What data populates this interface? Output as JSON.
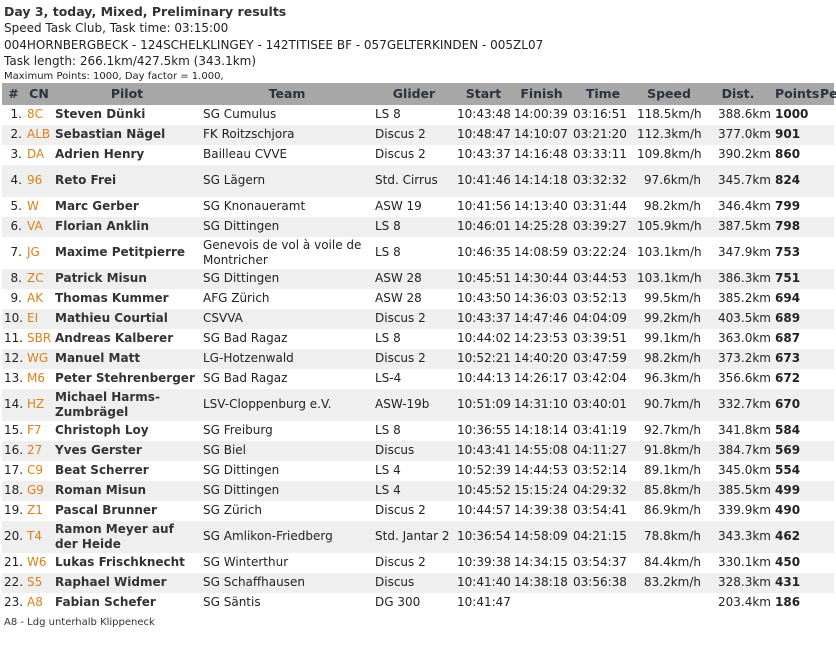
{
  "header": {
    "title": "Day 3, today, Mixed, Preliminary results",
    "competition": "Speed Task Club, Task time: 03:15:00",
    "route": "004HORNBERGBECK - 124SCHELKLINGEY - 142TITISEE BF - 057GELTERKINDEN - 005ZL07",
    "task_length": "Task length: 266.1km/427.5km (343.1km)",
    "max_points": "Maximum Points: 1000, Day factor = 1.000,"
  },
  "columns": [
    "#",
    "CN",
    "Pilot",
    "Team",
    "Glider",
    "Start",
    "Finish",
    "Time",
    "Speed",
    "Dist.",
    "Points",
    "Pen."
  ],
  "rows": [
    {
      "rank": "1.",
      "cn": "8C",
      "pilot": "Steven Dünki",
      "team": "SG Cumulus",
      "glider": "LS 8",
      "start": "10:43:48",
      "finish": "14:00:39",
      "time": "03:16:51",
      "speed": "118.5km/h",
      "dist": "388.6km",
      "points": "1000",
      "pen": ""
    },
    {
      "rank": "2.",
      "cn": "ALB",
      "pilot": "Sebastian Nägel",
      "team": "FK Roitzschjora",
      "glider": "Discus 2",
      "start": "10:48:47",
      "finish": "14:10:07",
      "time": "03:21:20",
      "speed": "112.3km/h",
      "dist": "377.0km",
      "points": "901",
      "pen": ""
    },
    {
      "rank": "3.",
      "cn": "DA",
      "pilot": "Adrien Henry",
      "team": "Bailleau CVVE",
      "glider": "Discus 2",
      "start": "10:43:37",
      "finish": "14:16:48",
      "time": "03:33:11",
      "speed": "109.8km/h",
      "dist": "390.2km",
      "points": "860",
      "pen": ""
    },
    {
      "rank": "4.",
      "cn": "96",
      "pilot": "Reto Frei",
      "team": "SG Lägern",
      "glider": "Std. Cirrus",
      "start": "10:41:46",
      "finish": "14:14:18",
      "time": "03:32:32",
      "speed": "97.6km/h",
      "dist": "345.7km",
      "points": "824",
      "pen": "",
      "tall": true
    },
    {
      "rank": "5.",
      "cn": "W",
      "pilot": "Marc Gerber",
      "team": "SG Knonaueramt",
      "glider": "ASW 19",
      "start": "10:41:56",
      "finish": "14:13:40",
      "time": "03:31:44",
      "speed": "98.2km/h",
      "dist": "346.4km",
      "points": "799",
      "pen": ""
    },
    {
      "rank": "6.",
      "cn": "VA",
      "pilot": "Florian Anklin",
      "team": "SG Dittingen",
      "glider": "LS 8",
      "start": "10:46:01",
      "finish": "14:25:28",
      "time": "03:39:27",
      "speed": "105.9km/h",
      "dist": "387.5km",
      "points": "798",
      "pen": ""
    },
    {
      "rank": "7.",
      "cn": "JG",
      "pilot": "Maxime Petitpierre",
      "team": "Genevois de vol à voile de Montricher",
      "glider": "LS 8",
      "start": "10:46:35",
      "finish": "14:08:59",
      "time": "03:22:24",
      "speed": "103.1km/h",
      "dist": "347.9km",
      "points": "753",
      "pen": "",
      "tall": true
    },
    {
      "rank": "8.",
      "cn": "ZC",
      "pilot": "Patrick Misun",
      "team": "SG Dittingen",
      "glider": "ASW 28",
      "start": "10:45:51",
      "finish": "14:30:44",
      "time": "03:44:53",
      "speed": "103.1km/h",
      "dist": "386.3km",
      "points": "751",
      "pen": ""
    },
    {
      "rank": "9.",
      "cn": "AK",
      "pilot": "Thomas Kummer",
      "team": "AFG Zürich",
      "glider": "ASW 28",
      "start": "10:43:50",
      "finish": "14:36:03",
      "time": "03:52:13",
      "speed": "99.5km/h",
      "dist": "385.2km",
      "points": "694",
      "pen": ""
    },
    {
      "rank": "10.",
      "cn": "EI",
      "pilot": "Mathieu Courtial",
      "team": "CSVVA",
      "glider": "Discus 2",
      "start": "10:43:37",
      "finish": "14:47:46",
      "time": "04:04:09",
      "speed": "99.2km/h",
      "dist": "403.5km",
      "points": "689",
      "pen": ""
    },
    {
      "rank": "11.",
      "cn": "SBR",
      "pilot": "Andreas Kalberer",
      "team": "SG Bad Ragaz",
      "glider": "LS 8",
      "start": "10:44:02",
      "finish": "14:23:53",
      "time": "03:39:51",
      "speed": "99.1km/h",
      "dist": "363.0km",
      "points": "687",
      "pen": ""
    },
    {
      "rank": "12.",
      "cn": "WG",
      "pilot": "Manuel Matt",
      "team": "LG-Hotzenwald",
      "glider": "Discus 2",
      "start": "10:52:21",
      "finish": "14:40:20",
      "time": "03:47:59",
      "speed": "98.2km/h",
      "dist": "373.2km",
      "points": "673",
      "pen": ""
    },
    {
      "rank": "13.",
      "cn": "M6",
      "pilot": "Peter Stehrenberger",
      "team": "SG Bad Ragaz",
      "glider": "LS-4",
      "start": "10:44:13",
      "finish": "14:26:17",
      "time": "03:42:04",
      "speed": "96.3km/h",
      "dist": "356.6km",
      "points": "672",
      "pen": ""
    },
    {
      "rank": "14.",
      "cn": "HZ",
      "pilot": "Michael Harms-Zumbrägel",
      "team": "LSV-Cloppenburg e.V.",
      "glider": "ASW-19b",
      "start": "10:51:09",
      "finish": "14:31:10",
      "time": "03:40:01",
      "speed": "90.7km/h",
      "dist": "332.7km",
      "points": "670",
      "pen": "",
      "tall": true
    },
    {
      "rank": "15.",
      "cn": "F7",
      "pilot": "Christoph Loy",
      "team": "SG Freiburg",
      "glider": "LS 8",
      "start": "10:36:55",
      "finish": "14:18:14",
      "time": "03:41:19",
      "speed": "92.7km/h",
      "dist": "341.8km",
      "points": "584",
      "pen": ""
    },
    {
      "rank": "16.",
      "cn": "27",
      "pilot": "Yves Gerster",
      "team": "SG Biel",
      "glider": "Discus",
      "start": "10:43:41",
      "finish": "14:55:08",
      "time": "04:11:27",
      "speed": "91.8km/h",
      "dist": "384.7km",
      "points": "569",
      "pen": ""
    },
    {
      "rank": "17.",
      "cn": "C9",
      "pilot": "Beat Scherrer",
      "team": "SG Dittingen",
      "glider": "LS 4",
      "start": "10:52:39",
      "finish": "14:44:53",
      "time": "03:52:14",
      "speed": "89.1km/h",
      "dist": "345.0km",
      "points": "554",
      "pen": ""
    },
    {
      "rank": "18.",
      "cn": "G9",
      "pilot": "Roman Misun",
      "team": "SG Dittingen",
      "glider": "LS 4",
      "start": "10:45:52",
      "finish": "15:15:24",
      "time": "04:29:32",
      "speed": "85.8km/h",
      "dist": "385.5km",
      "points": "499",
      "pen": ""
    },
    {
      "rank": "19.",
      "cn": "Z1",
      "pilot": "Pascal Brunner",
      "team": "SG Zürich",
      "glider": "Discus 2",
      "start": "10:44:57",
      "finish": "14:39:38",
      "time": "03:54:41",
      "speed": "86.9km/h",
      "dist": "339.9km",
      "points": "490",
      "pen": ""
    },
    {
      "rank": "20.",
      "cn": "T4",
      "pilot": "Ramon Meyer auf der Heide",
      "team": "SG Amlikon-Friedberg",
      "glider": "Std. Jantar 2",
      "start": "10:36:54",
      "finish": "14:58:09",
      "time": "04:21:15",
      "speed": "78.8km/h",
      "dist": "343.3km",
      "points": "462",
      "pen": "",
      "tall": true
    },
    {
      "rank": "21.",
      "cn": "W6",
      "pilot": "Lukas Frischknecht",
      "team": "SG Winterthur",
      "glider": "Discus 2",
      "start": "10:39:38",
      "finish": "14:34:15",
      "time": "03:54:37",
      "speed": "84.4km/h",
      "dist": "330.1km",
      "points": "450",
      "pen": ""
    },
    {
      "rank": "22.",
      "cn": "S5",
      "pilot": "Raphael Widmer",
      "team": "SG Schaffhausen",
      "glider": "Discus",
      "start": "10:41:40",
      "finish": "14:38:18",
      "time": "03:56:38",
      "speed": "83.2km/h",
      "dist": "328.3km",
      "points": "431",
      "pen": ""
    },
    {
      "rank": "23.",
      "cn": "A8",
      "pilot": "Fabian Schefer",
      "team": "SG Säntis",
      "glider": "DG 300",
      "start": "10:41:47",
      "finish": "",
      "time": "",
      "speed": "",
      "dist": "203.4km",
      "points": "186",
      "pen": ""
    }
  ],
  "footer": "A8 - Ldg unterhalb Klippeneck"
}
